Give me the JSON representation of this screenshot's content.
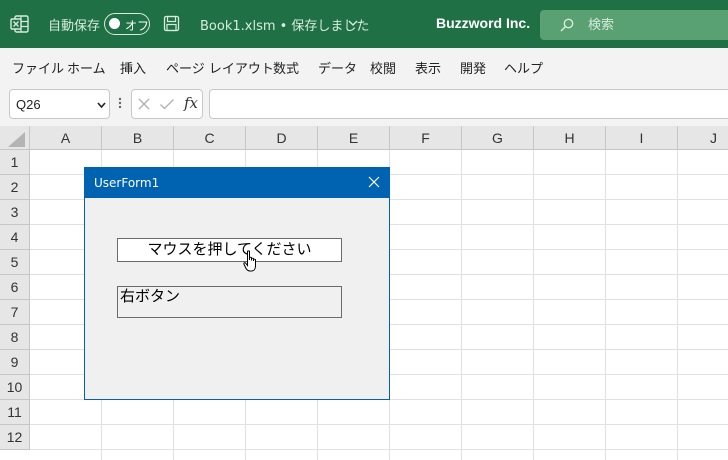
{
  "titlebar": {
    "autosave_label": "自動保存",
    "autosave_state": "オフ",
    "document_title": "Book1.xlsm • 保存しました",
    "account_name": "Buzzword Inc.",
    "search_placeholder": "検索",
    "icons": [
      "excel-app-icon",
      "save-icon",
      "chevron-down-icon",
      "search-icon"
    ],
    "colors": {
      "titlebar": "#1f7145",
      "search_box": "#59a072"
    }
  },
  "menu": {
    "items": [
      "ファイル",
      "ホーム",
      "挿入",
      "ページ レイアウト",
      "数式",
      "データ",
      "校閲",
      "表示",
      "開発",
      "ヘルプ"
    ]
  },
  "formula_bar": {
    "name_box": "Q26",
    "fx_label": "fx",
    "formula_value": "",
    "icons": [
      "cancel-icon",
      "enter-icon",
      "fx-icon"
    ]
  },
  "sheet": {
    "columns": [
      "A",
      "B",
      "C",
      "D",
      "E",
      "F",
      "G",
      "H",
      "I",
      "J"
    ],
    "rows": [
      "1",
      "2",
      "3",
      "4",
      "5",
      "6",
      "7",
      "8",
      "9",
      "10",
      "11",
      "12"
    ]
  },
  "userform": {
    "title": "UserForm1",
    "label_text": "マウスを押してください",
    "textbox_value": "右ボタン",
    "colors": {
      "titlebar": "#0063b1",
      "body": "#f0f0f0"
    }
  }
}
